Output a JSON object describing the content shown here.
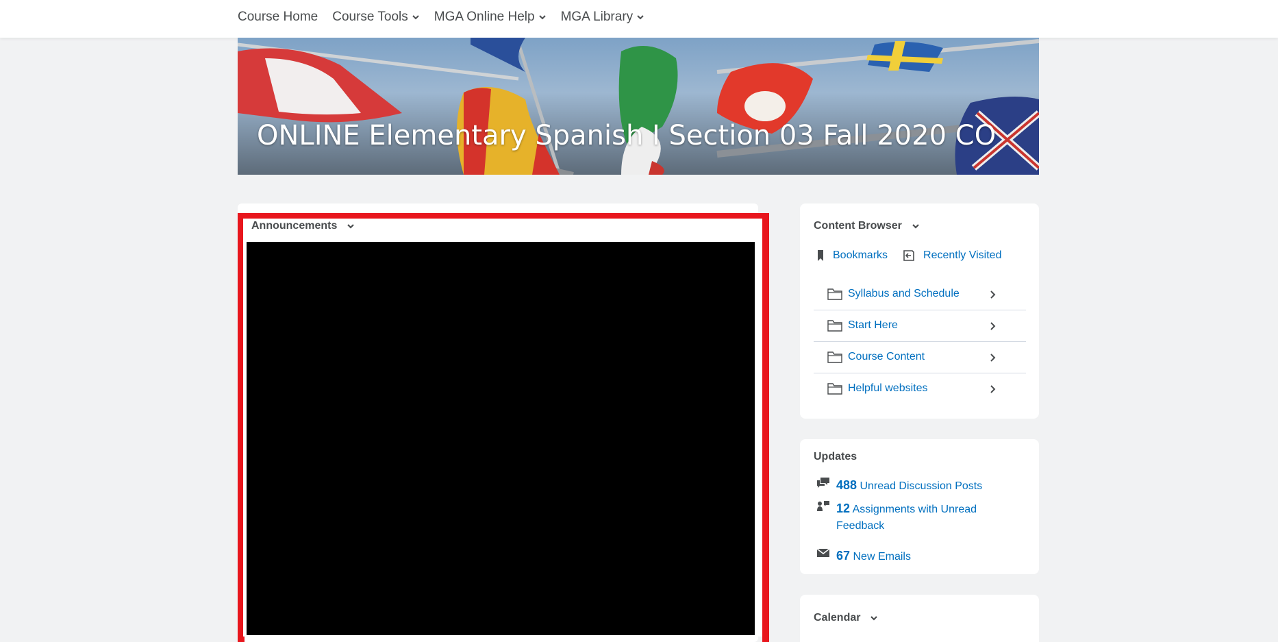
{
  "nav": {
    "items": [
      {
        "label": "Course Home",
        "has_menu": false
      },
      {
        "label": "Course Tools",
        "has_menu": true
      },
      {
        "label": "MGA Online Help",
        "has_menu": true
      },
      {
        "label": "MGA Library",
        "has_menu": true
      }
    ]
  },
  "banner": {
    "title": "ONLINE Elementary Spanish I Section 03 Fall 2020 CO"
  },
  "announcements": {
    "title": "Announcements"
  },
  "content_browser": {
    "title": "Content Browser",
    "bookmarks_label": "Bookmarks",
    "recent_label": "Recently Visited",
    "modules": [
      {
        "label": "Syllabus and Schedule"
      },
      {
        "label": "Start Here"
      },
      {
        "label": "Course Content"
      },
      {
        "label": "Helpful websites"
      }
    ]
  },
  "updates": {
    "title": "Updates",
    "items": [
      {
        "count": "488",
        "label": "Unread Discussion Posts",
        "icon": "discussion-icon"
      },
      {
        "count": "12",
        "label": "Assignments with Unread",
        "label2": "Feedback",
        "icon": "assignment-icon"
      },
      {
        "count": "67",
        "label": "New Emails",
        "icon": "email-icon"
      }
    ]
  },
  "calendar": {
    "title": "Calendar"
  },
  "colors": {
    "link": "#006fbf",
    "highlight": "#e8161d",
    "text": "#494c4e"
  }
}
